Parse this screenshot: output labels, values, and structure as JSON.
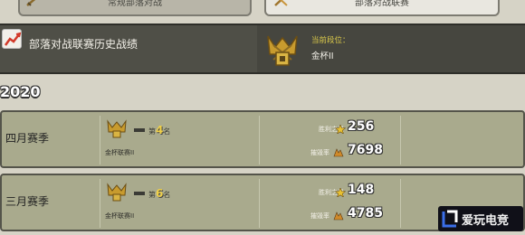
{
  "tabs": [
    {
      "label": "常规部落对战"
    },
    {
      "label": "部落对战联赛"
    }
  ],
  "header": {
    "history_title": "部落对战联赛历史战绩",
    "current_rank_label": "当前段位：",
    "current_league": "金杯II"
  },
  "year": "2020",
  "seasons": [
    {
      "name": "四月赛季",
      "rank_number": "4",
      "rank_prefix": "第",
      "rank_suffix": "名",
      "league": "金杯联赛II",
      "stars_label": "胜利之星",
      "stars_value": "256",
      "destruction_label": "摧毁率",
      "destruction_value": "7698"
    },
    {
      "name": "三月赛季",
      "rank_number": "6",
      "rank_prefix": "第",
      "rank_suffix": "名",
      "league": "金杯联赛II",
      "stars_label": "胜利之星",
      "stars_value": "148",
      "destruction_label": "摧毁率",
      "destruction_value": "4785"
    }
  ],
  "watermark": {
    "text": "爱玩电竞"
  }
}
